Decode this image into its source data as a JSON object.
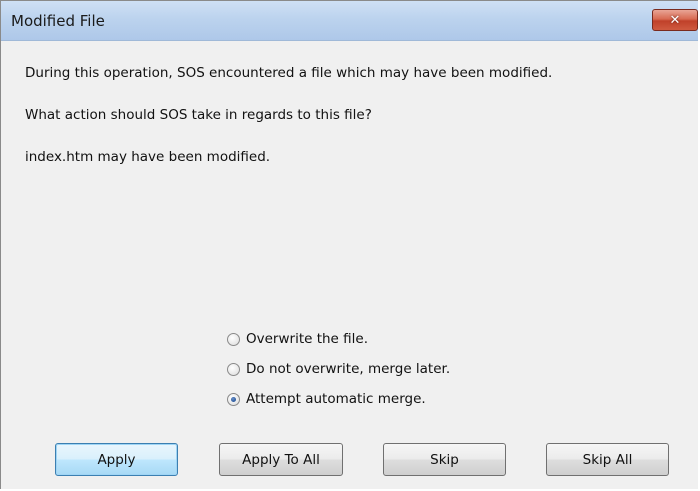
{
  "window": {
    "title": "Modified File",
    "close_icon": "close-icon",
    "close_glyph": "✕"
  },
  "messages": {
    "line1": "During this operation, SOS encountered a file which may have been modified.",
    "line2": "What action should SOS take in regards to this file?",
    "line3": "index.htm may have been modified."
  },
  "options": [
    {
      "label": "Overwrite the file.",
      "checked": false
    },
    {
      "label": "Do not overwrite, merge later.",
      "checked": false
    },
    {
      "label": "Attempt automatic merge.",
      "checked": true
    }
  ],
  "buttons": {
    "apply": "Apply",
    "apply_to_all": "Apply To All",
    "skip": "Skip",
    "skip_all": "Skip All"
  },
  "colors": {
    "title_bar": "#bcd3ee",
    "close_button": "#c0412a",
    "background": "#f0f0f0",
    "default_button_border": "#3c7fb1"
  }
}
